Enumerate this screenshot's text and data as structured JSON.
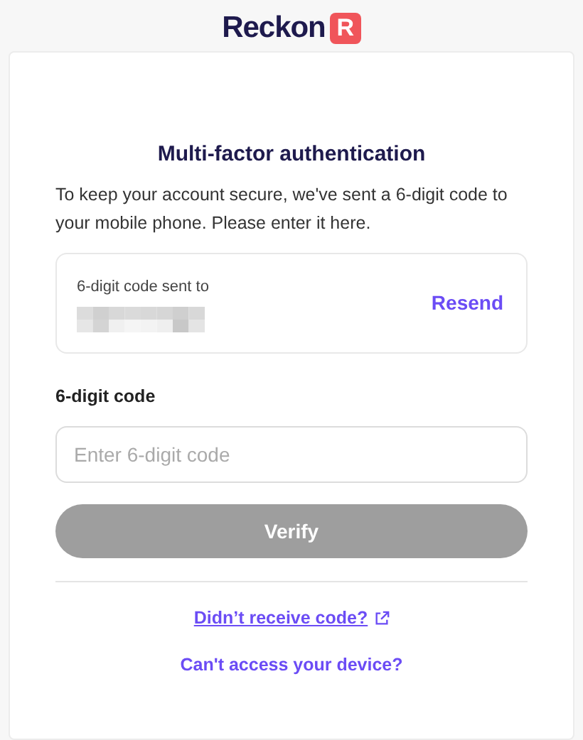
{
  "logo": {
    "wordmark": "Reckon",
    "badge": "R"
  },
  "title": "Multi-factor authentication",
  "intro": "To keep your account secure, we've sent a 6-digit code to your mobile phone. Please enter it here.",
  "sent_box": {
    "label": "6-digit code sent to",
    "resend": "Resend"
  },
  "code_field": {
    "label": "6-digit code",
    "placeholder": "Enter 6-digit code"
  },
  "verify_button": {
    "label": "Verify",
    "disabled": true
  },
  "links": [
    {
      "label": "Didn’t receive code?",
      "external": true,
      "underlined": true
    },
    {
      "label": "Can't access your device?",
      "external": false,
      "underlined": false
    }
  ]
}
